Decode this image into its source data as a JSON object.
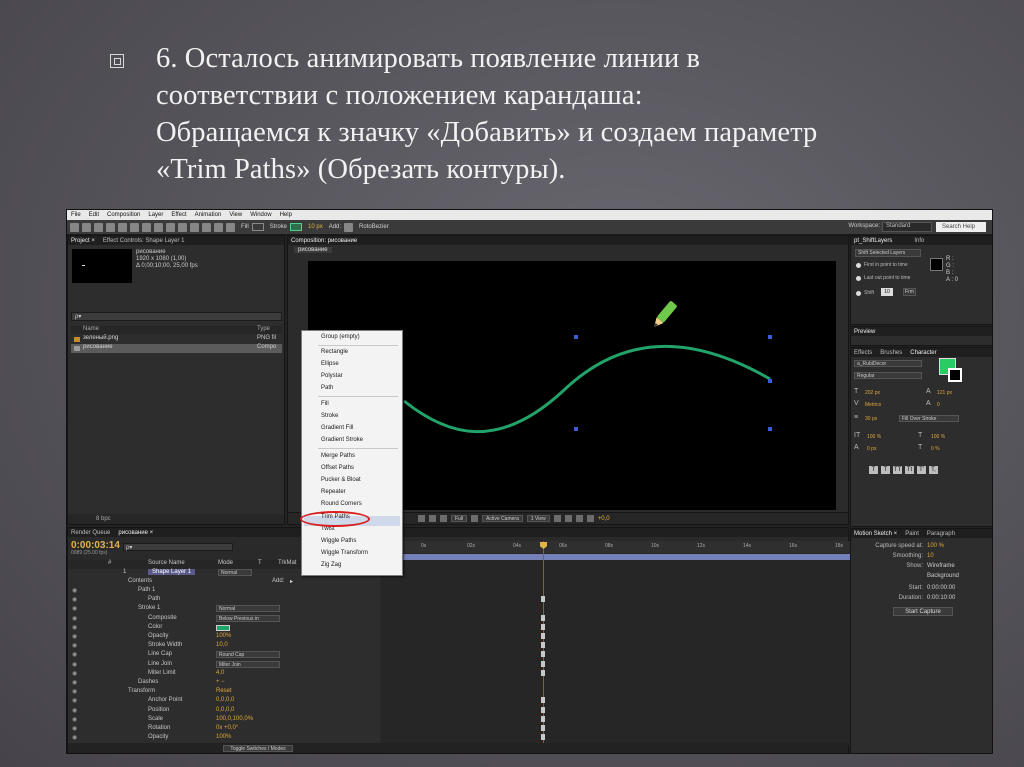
{
  "slide": {
    "lines": [
      "6. Осталось анимировать появление линии в",
      "соответствии с положением карандаша:",
      "Обращаемся к значку «Добавить» и создаем параметр",
      "«Trim Paths» (Обрезать контуры)."
    ]
  },
  "ae": {
    "menu": [
      "File",
      "Edit",
      "Composition",
      "Layer",
      "Effect",
      "Animation",
      "View",
      "Window",
      "Help"
    ],
    "toolbar": {
      "fill_label": "Fill",
      "stroke_label": "Stroke",
      "stroke_width": "10 px",
      "add_label": "Add:",
      "rotobezier": "RotoBezier",
      "workspace_label": "Workspace:",
      "workspace_value": "Standard",
      "search_placeholder": "Search Help"
    },
    "project": {
      "tabs": [
        "Project ×",
        "Effect Controls: Shape Layer 1"
      ],
      "comp_name": "рисование",
      "comp_info": [
        "1920 x 1080 (1,00)",
        "Δ 0;00;10;00, 25,00 fps"
      ],
      "search_value": "ρ▾",
      "col_name": "Name",
      "col_type": "Type",
      "items": [
        {
          "name": "зеленый.png",
          "type": "PNG fil"
        },
        {
          "name": "рисование",
          "type": "Compo"
        }
      ],
      "footer": "8 bpc"
    },
    "viewer": {
      "tab": "Composition: рисование",
      "breadcrumb": "рисование",
      "zoom": "Full",
      "camera": "Active Camera",
      "views": "1 View",
      "offset": "+0,0"
    },
    "context_menu": {
      "items": [
        "Group (empty)",
        "Rectangle",
        "Ellipse",
        "Polystar",
        "Path",
        "Fill",
        "Stroke",
        "Gradient Fill",
        "Gradient Stroke",
        "Merge Paths",
        "Offset Paths",
        "Pucker & Bloat",
        "Repeater",
        "Round Corners",
        "Trim Paths",
        "Twist",
        "Wiggle Paths",
        "Wiggle Transform",
        "Zig Zag"
      ],
      "highlighted": "Trim Paths"
    },
    "info": {
      "tabs": [
        "pt_ShiftLayers",
        "Info"
      ],
      "button": "Shift Selected Layers",
      "options": [
        "First in point to time",
        "Last out point to time"
      ],
      "shift_label": "Shift",
      "shift_value": "10",
      "shift_btn": "Frm",
      "rgba": [
        "R :",
        "G :",
        "B :",
        "A : 0"
      ]
    },
    "preview": {
      "tab": "Preview"
    },
    "character": {
      "tabs": [
        "Effects",
        "Brushes",
        "Character"
      ],
      "font": "a_RubiDecor",
      "style": "Regular",
      "size": "202 px",
      "leading": "121 px",
      "kerning": "Metrics",
      "tracking": "0",
      "stroke_px": "30 px",
      "stroke_mode": "Fill Over Stroke",
      "v_scale": "100 %",
      "h_scale": "100 %",
      "baseline": "0 px",
      "tsume": "0 %",
      "format_buttons": [
        "T",
        "T",
        "TT",
        "Tt",
        "T'",
        "T,"
      ],
      "fill_color": "#2bcb63"
    },
    "motion": {
      "tabs": [
        "Motion Sketch ×",
        "Paint",
        "Paragraph"
      ],
      "rows": [
        {
          "label": "Capture speed at:",
          "value": "100 %"
        },
        {
          "label": "Smoothing:",
          "value": "10"
        },
        {
          "label": "Show:",
          "value": "Wireframe"
        },
        {
          "label": "",
          "value": "Background"
        },
        {
          "label": "Start:",
          "value": "0:00:00:00"
        },
        {
          "label": "Duration:",
          "value": "0:00:10:00"
        }
      ],
      "button": "Start Capture"
    },
    "timeline": {
      "tabs": [
        "Render Queue",
        "рисование ×"
      ],
      "time": "0:00:03:14",
      "fps": "0089 (25.00 fps)",
      "search_value": "ρ▾",
      "columns": [
        "#",
        "Source Name",
        "Mode",
        "T",
        "TrkMat"
      ],
      "layer": {
        "index": "1",
        "name": "Shape Layer 1",
        "mode": "Normal"
      },
      "add_label": "Add:",
      "ruler": [
        "0s",
        "02s",
        "04s",
        "06s",
        "08s",
        "10s",
        "12s",
        "14s",
        "16s",
        "18s"
      ],
      "props": [
        {
          "name": "Contents",
          "indent": 1,
          "value": ""
        },
        {
          "name": "Path 1",
          "indent": 2,
          "value": ""
        },
        {
          "name": "Path",
          "indent": 3,
          "value": ""
        },
        {
          "name": "Stroke 1",
          "indent": 2,
          "value": "",
          "dd": "Normal"
        },
        {
          "name": "Composite",
          "indent": 3,
          "value": "",
          "dd": "Below Previous in"
        },
        {
          "name": "Color",
          "indent": 3,
          "value": ""
        },
        {
          "name": "Opacity",
          "indent": 3,
          "value": "100%"
        },
        {
          "name": "Stroke Width",
          "indent": 3,
          "value": "10,0"
        },
        {
          "name": "Line Cap",
          "indent": 3,
          "value": "",
          "dd": "Round Cap"
        },
        {
          "name": "Line Join",
          "indent": 3,
          "value": "",
          "dd": "Miter Join"
        },
        {
          "name": "Miter Limit",
          "indent": 3,
          "value": "4,0"
        },
        {
          "name": "Dashes",
          "indent": 2,
          "value": "+ −"
        },
        {
          "name": "Transform",
          "indent": 1,
          "value": "Reset"
        },
        {
          "name": "Anchor Point",
          "indent": 3,
          "value": "0,0,0,0"
        },
        {
          "name": "Position",
          "indent": 3,
          "value": "0,0,0,0"
        },
        {
          "name": "Scale",
          "indent": 3,
          "value": "100,0,100,0%"
        },
        {
          "name": "Rotation",
          "indent": 3,
          "value": "0x +0,0°"
        },
        {
          "name": "Opacity",
          "indent": 3,
          "value": "100%"
        }
      ],
      "footer_switch": "Toggle Switches / Modes"
    },
    "stroke_color": "#22a36a"
  }
}
